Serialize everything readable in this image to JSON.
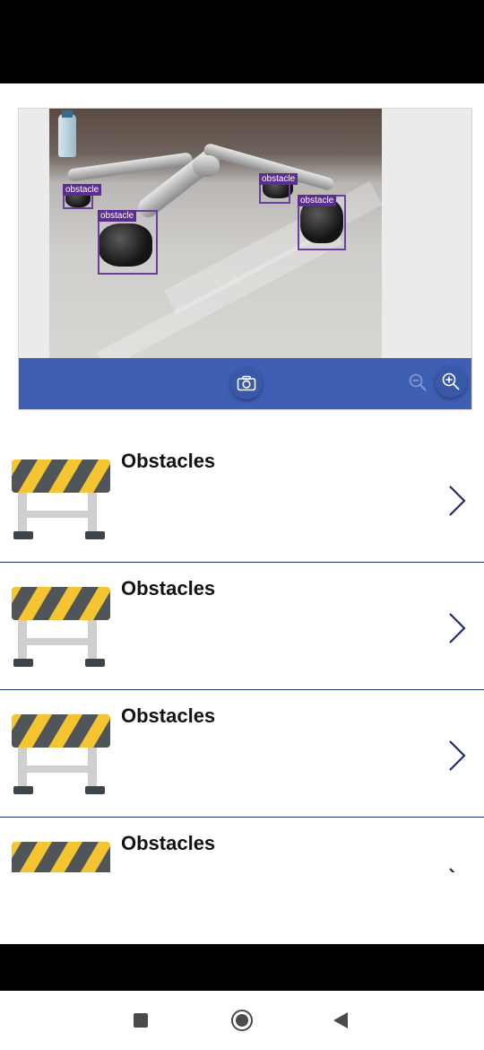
{
  "detections": [
    {
      "label": "obstacle"
    },
    {
      "label": "obstacle"
    },
    {
      "label": "obstacle"
    },
    {
      "label": "obstacle"
    }
  ],
  "toolbar": {
    "camera_icon": "camera-icon",
    "zoom_out_icon": "zoom-out-icon",
    "zoom_in_icon": "zoom-in-icon",
    "accent": "#3f5fb5"
  },
  "list": {
    "items": [
      {
        "title": "Obstacles",
        "icon": "road-barrier-icon"
      },
      {
        "title": "Obstacles",
        "icon": "road-barrier-icon"
      },
      {
        "title": "Obstacles",
        "icon": "road-barrier-icon"
      },
      {
        "title": "Obstacles",
        "icon": "road-barrier-icon"
      }
    ],
    "divider_color": "#1f2d6b",
    "chevron_color": "#1f2d6b"
  },
  "navigation": {
    "recents_icon": "square-icon",
    "home_icon": "home-circle-icon",
    "back_icon": "back-triangle-icon"
  }
}
